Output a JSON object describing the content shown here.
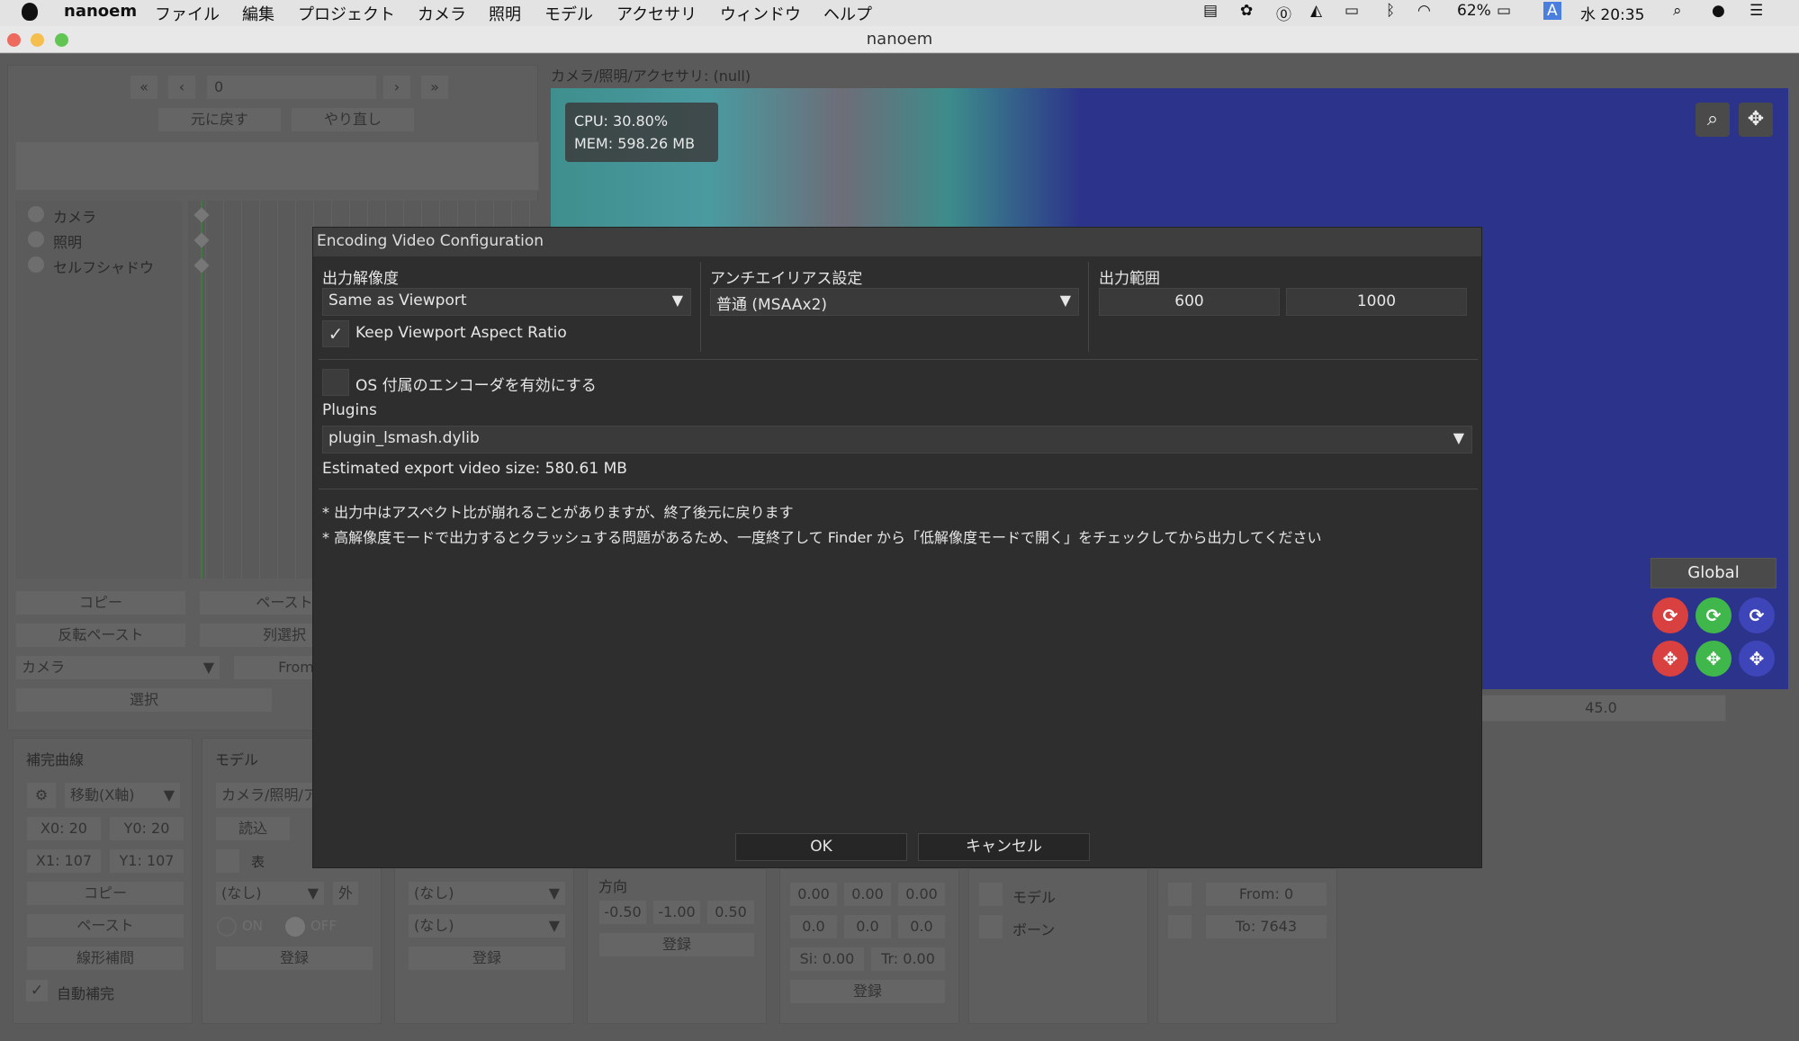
{
  "menubar": {
    "app_name": "nanoem",
    "items": [
      "ファイル",
      "編集",
      "プロジェクト",
      "カメラ",
      "照明",
      "モデル",
      "アクセサリ",
      "ウィンドウ",
      "ヘルプ"
    ],
    "battery": "62%",
    "input_mode": "A",
    "clock": "水 20:35"
  },
  "window": {
    "title": "nanoem"
  },
  "timeline": {
    "frame_value": "0",
    "undo_label": "元に戻す",
    "redo_label": "やり直し",
    "tracks": [
      "カメラ",
      "照明",
      "セルフシャドウ"
    ],
    "copy_label": "コピー",
    "paste_label": "ペースト",
    "reverse_paste_label": "反転ペースト",
    "column_select_label": "列選択",
    "select_target": "カメラ",
    "from_label": "From",
    "select_label": "選択"
  },
  "viewport": {
    "header": "カメラ/照明/アクセサリ: (null)",
    "cpu": "CPU: 30.80%",
    "mem": "MEM: 598.26 MB",
    "transform_mode": "Global",
    "fov_value": "45.0"
  },
  "bottom": {
    "interp_title": "補完曲線",
    "interp_target": "移動(X軸)",
    "x0": "X0: 20",
    "y0": "Y0: 20",
    "x1": "X1: 107",
    "y1": "Y1: 107",
    "copy_label": "コピー",
    "paste_label": "ペースト",
    "linear_label": "線形補間",
    "auto_interp_label": "自動補完",
    "model_title": "モデル",
    "model_value": "カメラ/照明/ア",
    "load_label": "読込",
    "show_label": "表",
    "none_1": "(なし)",
    "outside_label": "外",
    "on_label": "ON",
    "off_label": "OFF",
    "register_1": "登録",
    "none_2": "(なし)",
    "none_3": "(なし)",
    "register_2": "登録",
    "direction_title": "方向",
    "dir_x": "-0.50",
    "dir_y": "-1.00",
    "dir_z": "0.50",
    "register_3": "登録",
    "v1": "0.00",
    "v2": "0.00",
    "v3": "0.00",
    "v4": "0.0",
    "v5": "0.0",
    "v6": "0.0",
    "si": "Si: 0.00",
    "tr": "Tr: 0.00",
    "register_4": "登録",
    "model_check_label": "モデル",
    "bone_check_label": "ボーン",
    "from_value": "From: 0",
    "to_value": "To: 7643"
  },
  "dialog": {
    "title": "Encoding Video Configuration",
    "resolution_label": "出力解像度",
    "resolution_value": "Same as Viewport",
    "keep_aspect_label": "Keep Viewport Aspect Ratio",
    "keep_aspect_checked": true,
    "aa_label": "アンチエイリアス設定",
    "aa_value": "普通 (MSAAx2)",
    "range_label": "出力範囲",
    "range_from": "600",
    "range_to": "1000",
    "os_encoder_label": "OS 付属のエンコーダを有効にする",
    "os_encoder_checked": false,
    "plugins_label": "Plugins",
    "plugin_value": "plugin_lsmash.dylib",
    "estimated_size": "Estimated export video size: 580.61 MB",
    "note1": "* 出力中はアスペクト比が崩れることがありますが、終了後元に戻ります",
    "note2": "* 高解像度モードで出力するとクラッシュする問題があるため、一度終了して Finder から「低解像度モードで開く」をチェックしてから出力してください",
    "ok_label": "OK",
    "cancel_label": "キャンセル"
  }
}
